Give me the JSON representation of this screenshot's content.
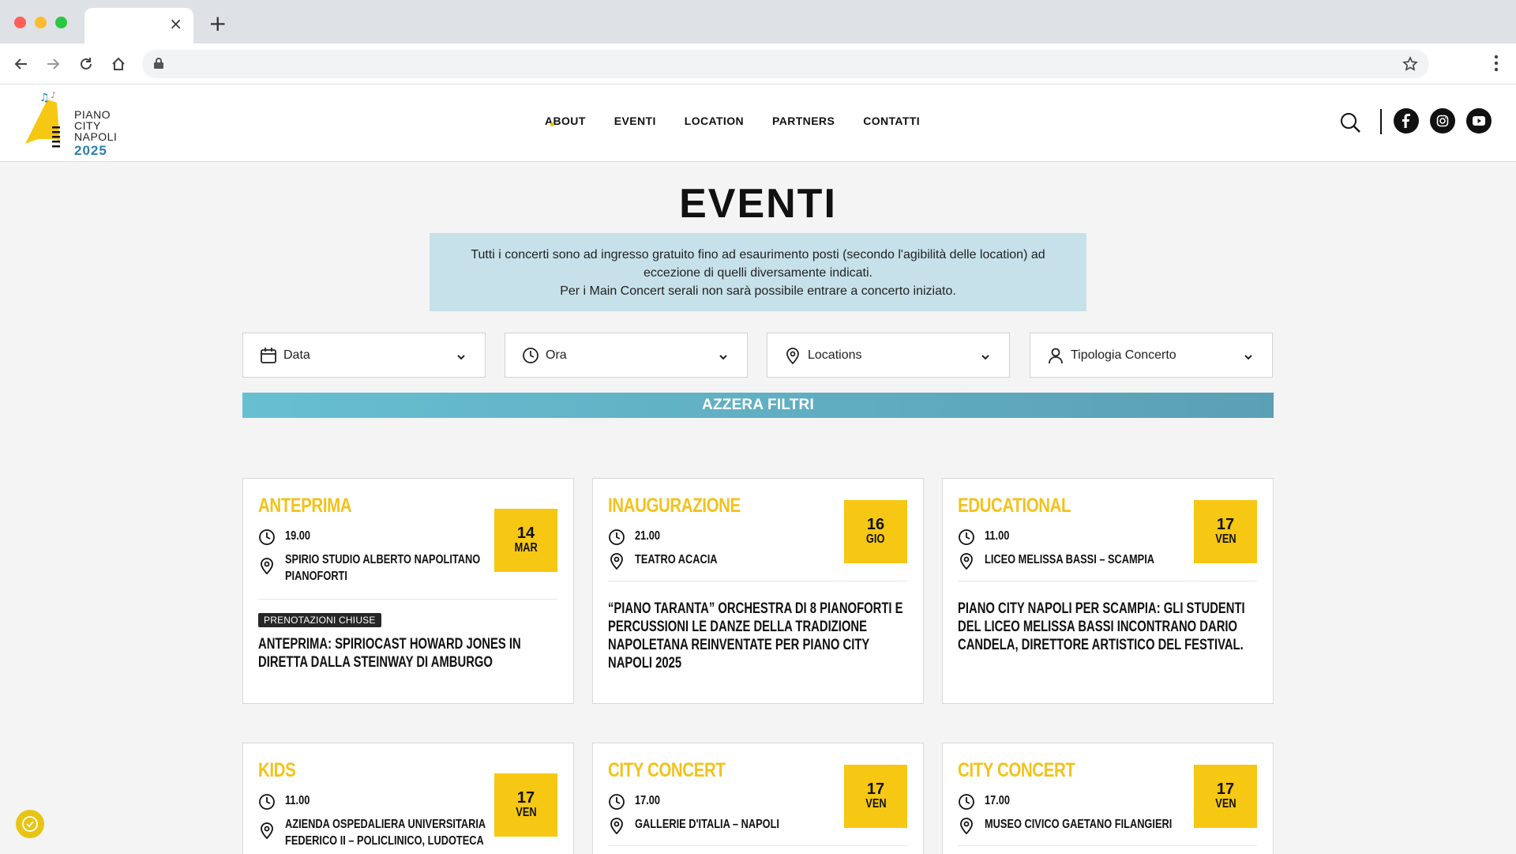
{
  "browser": {
    "tab_close": "×",
    "new_tab": "+"
  },
  "site": {
    "logo_lines": [
      "PIANO",
      "CITY",
      "NAPOLI"
    ],
    "logo_year": "2025",
    "nav": [
      "ABOUT",
      "EVENTI",
      "LOCATION",
      "PARTNERS",
      "CONTATTI"
    ]
  },
  "page": {
    "title": "EVENTI",
    "notice_line1": "Tutti i concerti sono ad ingresso gratuito fino ad esaurimento posti (secondo l'agibilità delle location) ad eccezione di quelli diversamente indicati.",
    "notice_line2": "Per i Main Concert serali non sarà possibile entrare a concerto iniziato."
  },
  "filters": [
    {
      "label": "Data",
      "icon": "calendar-icon"
    },
    {
      "label": "Ora",
      "icon": "clock-icon"
    },
    {
      "label": "Locations",
      "icon": "location-pin-icon"
    },
    {
      "label": "Tipologia Concerto",
      "icon": "person-icon"
    }
  ],
  "reset_label": "AZZERA FILTRI",
  "cards": [
    {
      "category": "ANTEPRIMA",
      "day_num": "14",
      "day_name": "MAR",
      "time": "19.00",
      "location": [
        "SPIRIO STUDIO ALBERTO NAPOLITANO",
        "PIANOFORTI"
      ],
      "badge": "PRENOTAZIONI CHIUSE",
      "title": "ANTEPRIMA: SPIRIOCAST HOWARD JONES IN DIRETTA DALLA STEINWAY DI AMBURGO"
    },
    {
      "category": "INAUGURAZIONE",
      "day_num": "16",
      "day_name": "GIO",
      "time": "21.00",
      "location": [
        "TEATRO ACACIA"
      ],
      "badge": "",
      "title": "“PIANO TARANTA” ORCHESTRA DI 8 PIANOFORTI E PERCUSSIONI LE DANZE DELLA TRADIZIONE NAPOLETANA REINVENTATE PER PIANO CITY NAPOLI 2025"
    },
    {
      "category": "EDUCATIONAL",
      "day_num": "17",
      "day_name": "VEN",
      "time": "11.00",
      "location": [
        "LICEO MELISSA BASSI – SCAMPIA"
      ],
      "badge": "",
      "title": "PIANO CITY NAPOLI PER SCAMPIA: GLI STUDENTI DEL LICEO MELISSA BASSI INCONTRANO DARIO CANDELA, DIRETTORE ARTISTICO DEL FESTIVAL."
    },
    {
      "category": "KIDS",
      "day_num": "17",
      "day_name": "VEN",
      "time": "11.00",
      "location": [
        "AZIENDA OSPEDALIERA UNIVERSITARIA",
        "FEDERICO II – POLICLINICO, LUDOTECA"
      ],
      "badge": "",
      "title": ""
    },
    {
      "category": "CITY CONCERT",
      "day_num": "17",
      "day_name": "VEN",
      "time": "17.00",
      "location": [
        "GALLERIE D'ITALIA – NAPOLI"
      ],
      "badge": "",
      "title": ""
    },
    {
      "category": "CITY CONCERT",
      "day_num": "17",
      "day_name": "VEN",
      "time": "17.00",
      "location": [
        "MUSEO CIVICO GAETANO FILANGIERI"
      ],
      "badge": "",
      "title": ""
    }
  ],
  "colors": {
    "accent_yellow": "#f6c713",
    "category_yellow": "#f3c21a",
    "notice_bg": "#c6e1e9",
    "reset_start": "#67bfd1",
    "reset_end": "#5b9fb5"
  }
}
